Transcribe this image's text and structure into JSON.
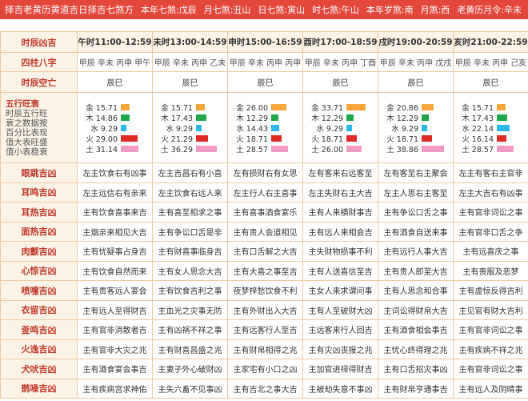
{
  "header": {
    "items": [
      "择吉老黄历黄道吉日择吉七煞方",
      "本年七煞:戊辰",
      "月七煞:丑山",
      "日七煞:寅山",
      "时七煞:午山",
      "本年岁煞:南",
      "月煞:西",
      "老黄历月令:辛未"
    ]
  },
  "table": {
    "corner": "时辰凶吉",
    "columns": [
      "午时11:00-12:59",
      "未时13:00-14:59",
      "申时15:00-16:59",
      "酉时17:00-18:59",
      "戌时19:00-20:59",
      "亥时21:00-22:59"
    ],
    "pillars": {
      "label": "四柱八字",
      "values": [
        "甲辰 辛未 丙申 甲午",
        "甲辰 辛未 丙申 乙未",
        "甲辰 辛未 丙申 丙申",
        "甲辰 辛未 丙申 丁酉",
        "甲辰 辛未 丙申 戊戌",
        "甲辰 辛未 丙申 己亥"
      ]
    },
    "kongwang": {
      "label": "时辰空亡",
      "values": [
        "辰巳",
        "辰巳",
        "辰巳",
        "辰巳",
        "辰巳",
        "辰巳"
      ]
    },
    "wuxing": {
      "label_lines": [
        "五行旺衰",
        "时辰五行旺",
        "衰之数据按",
        "百分比表现",
        "值大表旺盛",
        "值小表稳衰"
      ],
      "colors": {
        "金": "#f5a637",
        "木": "#1ea84a",
        "水": "#2bb8ee",
        "火": "#e02b24",
        "土": "#f19ac4"
      },
      "columns": [
        [
          {
            "el": "金",
            "value": 15.71
          },
          {
            "el": "木",
            "value": 14.86
          },
          {
            "el": "水",
            "value": 9.29
          },
          {
            "el": "火",
            "value": 29.0
          },
          {
            "el": "土",
            "value": 31.14
          }
        ],
        [
          {
            "el": "金",
            "value": 15.71
          },
          {
            "el": "木",
            "value": 17.43
          },
          {
            "el": "水",
            "value": 9.29
          },
          {
            "el": "火",
            "value": 21.29
          },
          {
            "el": "土",
            "value": 36.29
          }
        ],
        [
          {
            "el": "金",
            "value": 26.0
          },
          {
            "el": "木",
            "value": 12.29
          },
          {
            "el": "水",
            "value": 14.43
          },
          {
            "el": "火",
            "value": 18.71
          },
          {
            "el": "土",
            "value": 28.57
          }
        ],
        [
          {
            "el": "金",
            "value": 33.71
          },
          {
            "el": "木",
            "value": 12.29
          },
          {
            "el": "水",
            "value": 9.29
          },
          {
            "el": "火",
            "value": 18.71
          },
          {
            "el": "土",
            "value": 26.0
          }
        ],
        [
          {
            "el": "金",
            "value": 20.86
          },
          {
            "el": "木",
            "value": 12.29
          },
          {
            "el": "水",
            "value": 9.29
          },
          {
            "el": "火",
            "value": 18.71
          },
          {
            "el": "土",
            "value": 38.86
          }
        ],
        [
          {
            "el": "金",
            "value": 15.71
          },
          {
            "el": "木",
            "value": 17.43
          },
          {
            "el": "水",
            "value": 22.14
          },
          {
            "el": "火",
            "value": 16.14
          },
          {
            "el": "土",
            "value": 28.57
          }
        ]
      ]
    },
    "omens": [
      {
        "label": "眼跳吉凶",
        "values": [
          "左主饮食右有凶事",
          "左主吉昌右有小喜",
          "左有损财右有女思",
          "左有客来右远客至",
          "左有客至右主聚会",
          "左主有客右主官非"
        ]
      },
      {
        "label": "耳鸣吉凶",
        "values": [
          "左主远信右有亲来",
          "左主饮食右远人来",
          "左主行人右主喜事",
          "左主失财右主大吉",
          "左主人思右主客至",
          "左主大吉右有凶事"
        ]
      },
      {
        "label": "耳热吉凶",
        "values": [
          "主有饮食喜事来吉",
          "主有喜至相求之事",
          "主有喜事酒食宴乐",
          "主有人来横财事吉",
          "主有争讼口舌之事",
          "主有官非词讼之事"
        ]
      },
      {
        "label": "面热吉凶",
        "values": [
          "主烟亲来相见大吉",
          "主有争讼口舌是非",
          "主有贵人会道相见",
          "主有远人来相会吉",
          "主有酒食自送来事",
          "主有官非口舌之争"
        ]
      },
      {
        "label": "肉颤吉凶",
        "values": [
          "主有忧疑事占身吉",
          "主有财喜事临身吉",
          "主有口舌解之大吉",
          "主失财物损事不利",
          "主有远行人事大吉",
          "主有远喜庆之事"
        ]
      },
      {
        "label": "心惊吉凶",
        "values": [
          "主有饮食自然而来",
          "主有女人思念大吉",
          "主有大喜之事至吉",
          "主有人送喜信至吉",
          "主有贵人即至大吉",
          "主有喪服及恶梦"
        ]
      },
      {
        "label": "喷嚏吉凶",
        "values": [
          "主有贵客远人宴会",
          "主有饮食吉利之事",
          "夜梦梓愁饮食不利",
          "主女人来求谓问事",
          "主有人思念和合事",
          "主有虚惊反得吉利"
        ]
      },
      {
        "label": "衣留吉凶",
        "values": [
          "主有远人至得财吉",
          "主血光之灾事无防",
          "主有外财出入大吉",
          "主有人至破财大凶",
          "主词讼得财帛大吉",
          "主见官有财大吉利"
        ]
      },
      {
        "label": "釜鸣吉凶",
        "values": [
          "主有官非消散者吉",
          "主有凶祸不祥之事",
          "主有远客行人至吉",
          "主远客来行人回吉",
          "主有酒食相会事吉",
          "主有官非词讼之事"
        ]
      },
      {
        "label": "火逸吉凶",
        "values": [
          "主有官非大灾之兆",
          "主有财喜昌盛之兆",
          "主有财帛相得之兆",
          "主有灾凶丧报之兆",
          "主忧心终得理之兆",
          "主有疾病不祥之兆"
        ]
      },
      {
        "label": "犬吠吉凶",
        "values": [
          "主有酒食宴会事吉",
          "主妻子外心破财凶",
          "主家宅有小口之凶",
          "主加官进禄得财吉",
          "主有口舌招灾事凶",
          "主有官非词讼之事"
        ]
      },
      {
        "label": "鹊噪吉凶",
        "values": [
          "主有疾病宫求神佑",
          "主失六畜不见事凶",
          "主有吉北之事大吉",
          "主被劫失意不事凶",
          "主有财帛亨通事吉",
          "主有远人及阴晴事"
        ]
      }
    ]
  }
}
